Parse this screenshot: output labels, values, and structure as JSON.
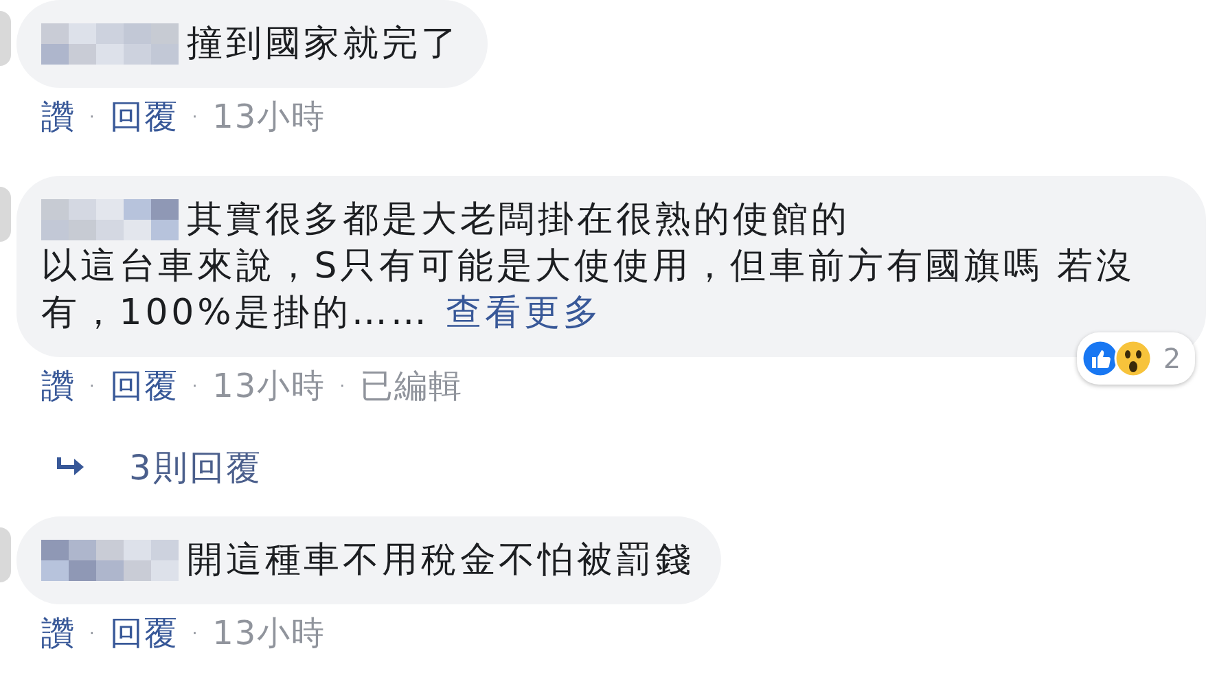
{
  "comments": [
    {
      "lines": [
        "撞到國家就完了"
      ],
      "actions": [
        {
          "kind": "link",
          "label": "讚"
        },
        {
          "kind": "link",
          "label": "回覆",
          "sep": "·"
        },
        {
          "kind": "time",
          "label": "13小時",
          "sep": "·"
        }
      ]
    },
    {
      "lines": [
        "其實很多都是大老闆掛在很熟的使館的",
        "以這台車來說，S只有可能是大使使用，但車前方有國旗嗎 若沒",
        "有，100%是掛的……"
      ],
      "see_more": "查看更多",
      "reactions": {
        "icons": [
          {
            "kind": "like"
          },
          {
            "kind": "wow"
          }
        ],
        "count": "2"
      },
      "actions": [
        {
          "kind": "link",
          "label": "讚"
        },
        {
          "kind": "link",
          "label": "回覆",
          "sep": "·"
        },
        {
          "kind": "time",
          "label": "13小時",
          "sep": "·"
        },
        {
          "kind": "time",
          "label": "已編輯",
          "sep": "·"
        }
      ],
      "replies": {
        "label": "3則回覆"
      }
    },
    {
      "lines": [
        "開這種車不用稅金不怕被罰錢"
      ],
      "actions": [
        {
          "kind": "link",
          "label": "讚"
        },
        {
          "kind": "link",
          "label": "回覆",
          "sep": "·"
        },
        {
          "kind": "time",
          "label": "13小時",
          "sep": "·"
        }
      ]
    }
  ]
}
